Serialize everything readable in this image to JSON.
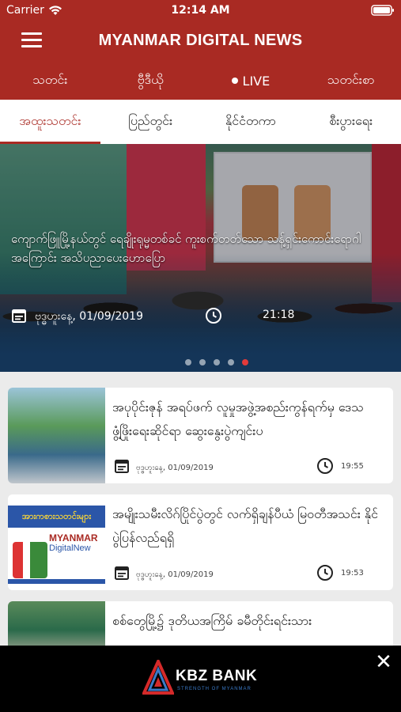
{
  "status_bar": {
    "carrier": "Carrier",
    "time": "12:14 AM"
  },
  "header": {
    "title": "MYANMAR DIGITAL NEWS"
  },
  "main_tabs": [
    {
      "label": "သတင်း"
    },
    {
      "label": "ဗွီဒီယို"
    },
    {
      "label": "LIVE"
    },
    {
      "label": "သတင်းစာ"
    }
  ],
  "sub_tabs": [
    {
      "label": "အထူးသတင်း",
      "active": true
    },
    {
      "label": "ပြည်တွင်း",
      "active": false
    },
    {
      "label": "နိုင်ငံတကာ",
      "active": false
    },
    {
      "label": "စီးပွားရေး",
      "active": false
    }
  ],
  "featured": {
    "headline": "ကျောက်ဖြူမြို့နယ်တွင် ရေချိုးရုမ္မတစ်ခင် ကူးစက်တတ်သော သန့်ရှင်းကောင်းရောဂါအကြောင်း အသိပညာပေးဟောပြော",
    "date": "ဗုဒ္ဓဟူးနေ့, 01/09/2019",
    "time": "21:18",
    "slide_count": 5,
    "active_slide": 5
  },
  "news": [
    {
      "title": "အပုပိုင်းဇုန် အရပ်ဖက် လူမှုအဖွဲ့အစည်းကွန်ရက်မှ ဒေသဖွံ့ဖြိုးရေးဆိုင်ရာ ဆွေးနွေးပွဲကျင်းပ",
      "date": "ဗုဒ္ဓဟူးနေ့, 01/09/2019",
      "time": "19:55"
    },
    {
      "title": "အမျိုးသမီးလိဂ်ပြိုင်ပွဲတွင် လက်ရှိချန်ပီယံ မြဝတီအသင်း နိုင်ပွဲပြန်လည်ရရှိ",
      "date": "ဗုဒ္ဓဟူးနေ့, 01/09/2019",
      "time": "19:53",
      "thumb_banner": "အားကစားသတင်းများ",
      "thumb_logo_1": "MYANMAR",
      "thumb_logo_2": "DigitalNew"
    },
    {
      "title": "စစ်တွေမြို့၌ ဒုတိယအကြိမ် ခမီတိုင်းရင်းသား",
      "date": "",
      "time": ""
    }
  ],
  "ad": {
    "brand": "KBZ BANK",
    "tagline": "STRENGTH OF MYANMAR",
    "close_symbol": "✕"
  },
  "colors": {
    "primary": "#a92a23",
    "accent_dot": "#e23a3a",
    "ad_bg": "#000000",
    "kbz_blue": "#3a7ac8"
  }
}
